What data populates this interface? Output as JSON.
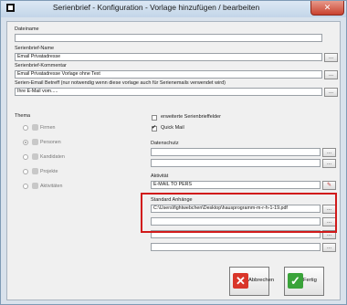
{
  "window": {
    "title": "Serienbrief - Konfiguration - Vorlage hinzufügen / bearbeiten",
    "close_label": "✕"
  },
  "form": {
    "dateiname": {
      "label": "Dateiname",
      "value": ""
    },
    "name": {
      "label": "Serienbrief-Name",
      "value": "Email Privatadresse"
    },
    "kommentar": {
      "label": "Serienbrief-Kommentar",
      "value": "Email Privatadresse Vorlage ohne Text"
    },
    "betreff": {
      "label": "Serien-Email Betreff (nur notwendig wenn diese vorlage auch für Serienemails verwendet wird)",
      "value": "Ihre E-Mail vom....."
    }
  },
  "thema": {
    "label": "Thema",
    "options": [
      {
        "label": "Firmen",
        "selected": false
      },
      {
        "label": "Personen",
        "selected": true
      },
      {
        "label": "Kandidaten",
        "selected": false
      },
      {
        "label": "Projekte",
        "selected": false
      },
      {
        "label": "Aktivitäten",
        "selected": false
      }
    ]
  },
  "checkboxes": {
    "erweitert": {
      "label": "erweiterte Serienbrieffelder",
      "checked": false
    },
    "quickmail": {
      "label": "Quick Mail",
      "checked": true
    }
  },
  "datenschutz": {
    "label": "Datenschutz"
  },
  "aktivitaet": {
    "label": "Aktivität",
    "value": "E-MAIL TO PERS"
  },
  "anhaenge": {
    "label": "Standard Anhänge",
    "first_value": "C:\\Users\\fightwebchen\\Desktop\\hausprogramm-m-r-h-1-19.pdf"
  },
  "buttons": {
    "browse": "...",
    "abbrechen": "Abbrechen",
    "fertig": "Fertig"
  },
  "colors": {
    "highlight": "#d11a1a",
    "cancel_icon": "#d9362a",
    "ok_icon": "#3aa33a"
  }
}
